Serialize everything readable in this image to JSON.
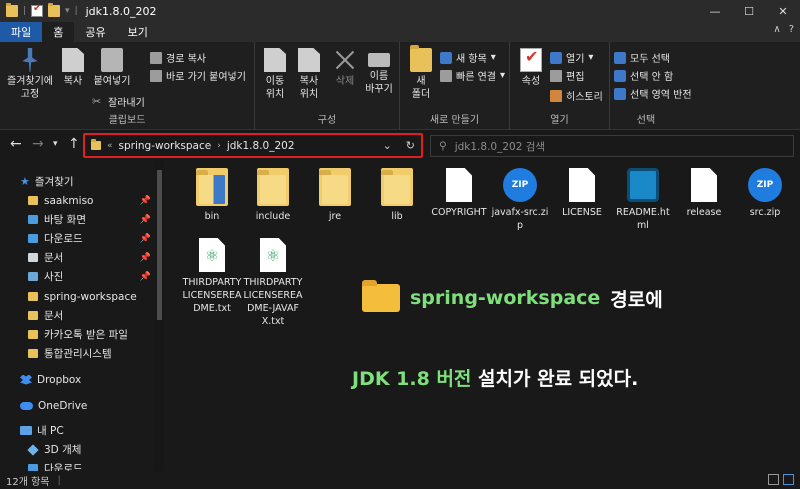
{
  "window": {
    "title": "jdk1.8.0_202",
    "controls": [
      "—",
      "☐",
      "✕"
    ]
  },
  "tabs": [
    {
      "label": "파일"
    },
    {
      "label": "홈"
    },
    {
      "label": "공유"
    },
    {
      "label": "보기"
    }
  ],
  "ribbon": {
    "clipboard": {
      "label": "클립보드",
      "pin_line1": "즐겨찾기에",
      "pin_line2": "고정",
      "copy": "복사",
      "paste": "붙여넣기",
      "copy_path": "경로 복사",
      "paste_shortcut": "바로 가기 붙여넣기",
      "cut": "잘라내기"
    },
    "organize": {
      "label": "구성",
      "move_line1": "이동",
      "move_line2": "위치",
      "copyto_line1": "복사",
      "copyto_line2": "위치",
      "delete": "삭제",
      "rename_line1": "이름",
      "rename_line2": "바꾸기"
    },
    "new": {
      "label": "새로 만들기",
      "folder_line1": "새",
      "folder_line2": "폴더",
      "new_item": "새 항목",
      "easy_access": "빠른 연결"
    },
    "open": {
      "label": "열기",
      "properties": "속성",
      "open": "열기",
      "edit": "편집",
      "history": "히스토리"
    },
    "select": {
      "label": "선택",
      "select_all": "모두 선택",
      "select_none": "선택 안 함",
      "invert": "선택 영역 반전"
    }
  },
  "address": {
    "crumbs": [
      "spring-workspace",
      "jdk1.8.0_202"
    ],
    "search_placeholder": "jdk1.8.0_202 검색"
  },
  "sidebar": {
    "quick_access": "즐겨찾기",
    "items": [
      {
        "label": "saakmiso",
        "pinned": true
      },
      {
        "label": "바탕 화면",
        "pinned": true
      },
      {
        "label": "다운로드",
        "pinned": true
      },
      {
        "label": "문서",
        "pinned": true
      },
      {
        "label": "사진",
        "pinned": true
      },
      {
        "label": "spring-workspace",
        "pinned": false
      },
      {
        "label": "문서",
        "pinned": false
      },
      {
        "label": "카카오톡 받은 파일",
        "pinned": false
      },
      {
        "label": "통합관리시스템",
        "pinned": false
      }
    ],
    "dropbox": "Dropbox",
    "onedrive": "OneDrive",
    "this_pc": "내 PC",
    "objects3d": "3D 개체",
    "downloads": "다운로드"
  },
  "files": [
    {
      "name": "bin",
      "type": "folder-blue"
    },
    {
      "name": "include",
      "type": "folder"
    },
    {
      "name": "jre",
      "type": "folder"
    },
    {
      "name": "lib",
      "type": "folder"
    },
    {
      "name": "COPYRIGHT",
      "type": "doc"
    },
    {
      "name": "javafx-src.zip",
      "type": "zip"
    },
    {
      "name": "LICENSE",
      "type": "doc"
    },
    {
      "name": "README.html",
      "type": "readme"
    },
    {
      "name": "release",
      "type": "doc"
    },
    {
      "name": "src.zip",
      "type": "zip"
    },
    {
      "name": "THIRDPARTYLICENSEREADME.txt",
      "type": "atom"
    },
    {
      "name": "THIRDPARTYLICENSEREADME-JAVAFX.txt",
      "type": "atom"
    }
  ],
  "annotation": {
    "line1_highlight": "spring-workspace",
    "line1_rest": "경로에",
    "line2_highlight": "JDK 1.8 버전",
    "line2_rest": "설치가 완료 되었다."
  },
  "status": {
    "count": "12개 항목"
  },
  "colors": {
    "accent": "#1f5aa6",
    "highlight_border": "#e02020",
    "annotation_green": "#7ee07a"
  }
}
